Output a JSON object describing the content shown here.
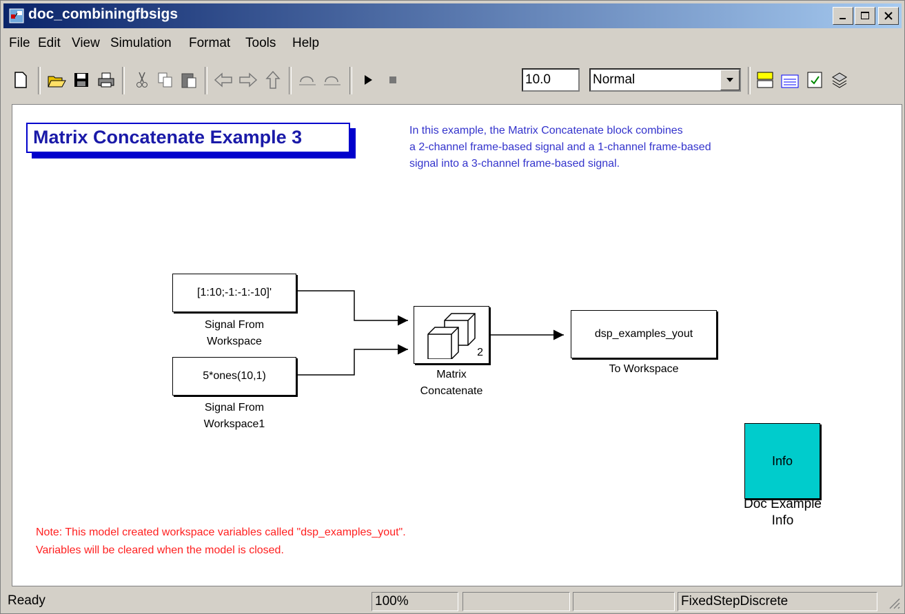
{
  "window": {
    "title": "doc_combiningfbsigs"
  },
  "menu": [
    "File",
    "Edit",
    "View",
    "Simulation",
    "Format",
    "Tools",
    "Help"
  ],
  "toolbar": {
    "stop_time": "10.0",
    "sim_mode": "Normal",
    "icons": [
      "new-icon",
      "open-icon",
      "save-icon",
      "print-icon",
      "cut-icon",
      "copy-icon",
      "paste-icon",
      "back-icon",
      "forward-icon",
      "up-icon",
      "undo-icon",
      "redo-icon",
      "start-icon",
      "stop-icon",
      "library-icon",
      "model-explorer-icon",
      "update-diagram-icon",
      "build-icon"
    ]
  },
  "canvas": {
    "heading": "Matrix Concatenate Example 3",
    "description": [
      "In this example, the Matrix Concatenate block combines",
      "a 2-channel frame-based signal and a 1-channel frame-based",
      "signal into a 3-channel frame-based signal."
    ],
    "blocks": {
      "sfw1": {
        "text": "[1:10;-1:-1:-10]'",
        "label1": "Signal From",
        "label2": "Workspace"
      },
      "sfw2": {
        "text": "5*ones(10,1)",
        "label1": "Signal From",
        "label2": "Workspace1"
      },
      "concat": {
        "port_count": "2",
        "label1": "Matrix",
        "label2": "Concatenate"
      },
      "tows": {
        "text": "dsp_examples_yout",
        "label": "To Workspace"
      },
      "info": {
        "text": "Info",
        "label1": "Doc Example",
        "label2": "Info",
        "color": "#00cccc"
      }
    },
    "note": [
      "Note: This model created workspace variables called \"dsp_examples_yout\".",
      "Variables will be cleared when the model is closed."
    ]
  },
  "status": {
    "state": "Ready",
    "zoom": "100%",
    "solver": "FixedStepDiscrete"
  }
}
